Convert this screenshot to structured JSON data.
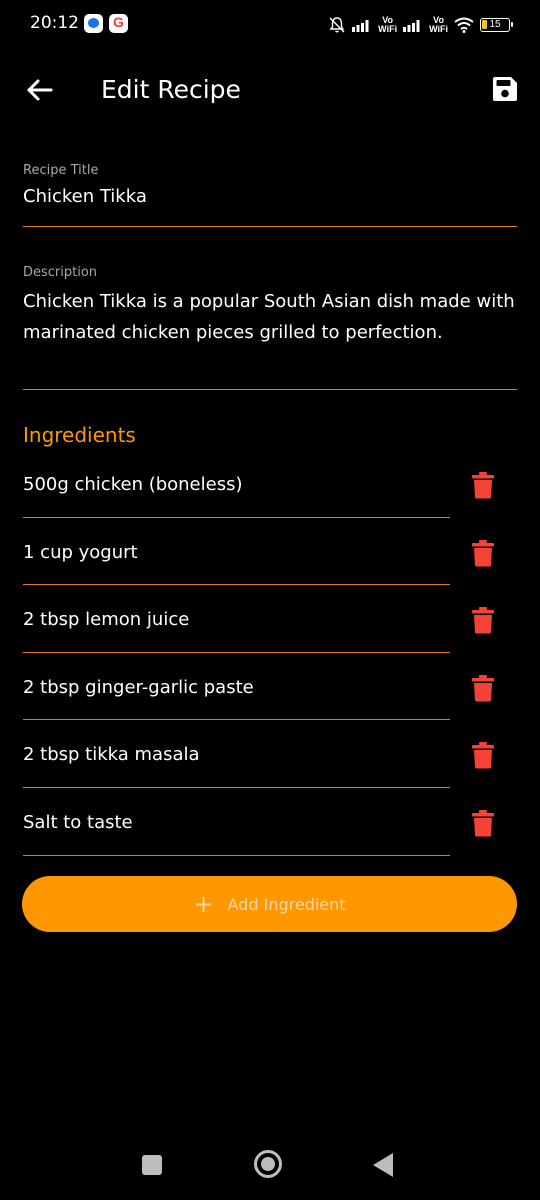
{
  "status_bar": {
    "time": "20:12",
    "icons": [
      "messages-icon",
      "google-icon",
      "silent-icon",
      "signal-icon",
      "signal-icon",
      "wifi-icon"
    ],
    "vo_wifi_label_1": "Vo",
    "vo_wifi_label_2": "WiFi",
    "battery_level": "15"
  },
  "header": {
    "title": "Edit Recipe",
    "back_icon": "arrow-left-icon",
    "save_icon": "save-icon"
  },
  "form": {
    "title_label": "Recipe Title",
    "title_value": "Chicken Tikka",
    "description_label": "Description",
    "description_value": "Chicken Tikka is a popular South Asian dish made with marinated chicken pieces grilled to perfection."
  },
  "ingredients": {
    "section_title": "Ingredients",
    "items": [
      "500g chicken (boneless)",
      "1 cup yogurt",
      "2 tbsp lemon juice",
      "2 tbsp ginger-garlic paste",
      "2 tbsp tikka masala",
      "Salt to taste"
    ],
    "delete_icon": "trash-icon",
    "add_button_label": "Add Ingredient",
    "add_icon": "plus-icon"
  },
  "colors": {
    "accent": "#ff9800",
    "underline": "#e07b1a",
    "delete": "#f44336",
    "background": "#000000"
  },
  "nav_bar": {
    "icons": [
      "recent-apps-icon",
      "home-icon",
      "back-icon"
    ]
  }
}
